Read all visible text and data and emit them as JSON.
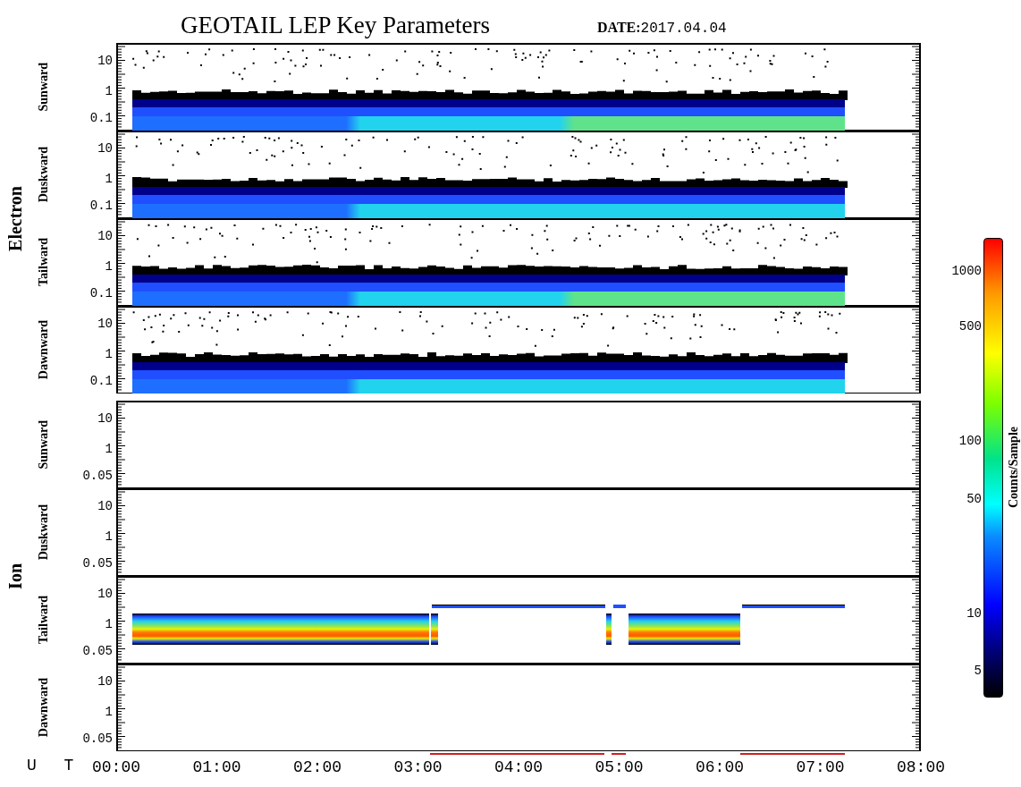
{
  "title": "GEOTAIL LEP Key Parameters",
  "date_label": "DATE:",
  "date": "2017.04.04",
  "groups": [
    {
      "name": "Electron",
      "panels": [
        {
          "direction": "Sunward",
          "kind": "electron",
          "yticks": [
            "10",
            "1",
            "0.1"
          ]
        },
        {
          "direction": "Duskward",
          "kind": "electron",
          "yticks": [
            "10",
            "1",
            "0.1"
          ]
        },
        {
          "direction": "Tailward",
          "kind": "electron",
          "yticks": [
            "10",
            "1",
            "0.1"
          ]
        },
        {
          "direction": "Dawnward",
          "kind": "electron",
          "yticks": [
            "10",
            "1",
            "0.1"
          ]
        }
      ]
    },
    {
      "name": "Ion",
      "panels": [
        {
          "direction": "Sunward",
          "kind": "empty",
          "yticks": [
            "10",
            "1",
            "0.05"
          ]
        },
        {
          "direction": "Duskward",
          "kind": "empty",
          "yticks": [
            "10",
            "1",
            "0.05"
          ]
        },
        {
          "direction": "Tailward",
          "kind": "ion",
          "yticks": [
            "10",
            "1",
            "0.05"
          ]
        },
        {
          "direction": "Dawnward",
          "kind": "empty",
          "yticks": [
            "10",
            "1",
            "0.05"
          ]
        }
      ]
    }
  ],
  "colorbar": {
    "title": "Counts/Sample",
    "ticks": [
      "1000",
      "500",
      "100",
      "50",
      "10",
      "5"
    ]
  },
  "x_axis": {
    "label": "U T",
    "ticks": [
      "00:00",
      "01:00",
      "02:00",
      "03:00",
      "04:00",
      "05:00",
      "06:00",
      "07:00",
      "08:00"
    ]
  }
}
